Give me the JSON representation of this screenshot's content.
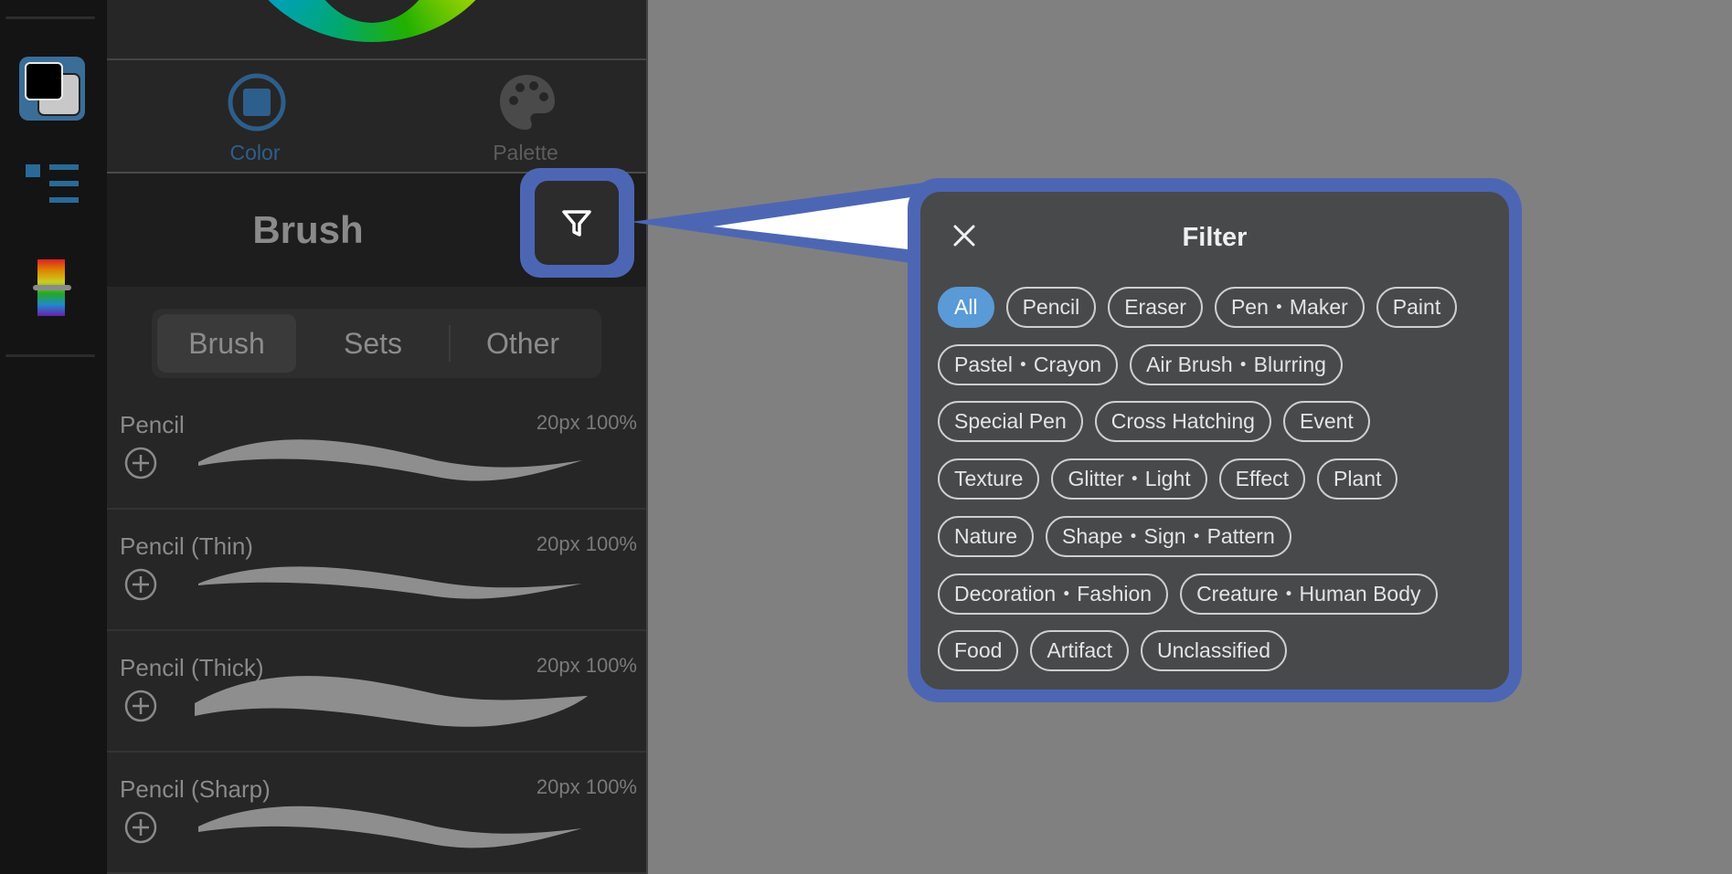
{
  "color_panel": {
    "tabs": [
      {
        "label": "Color",
        "icon": "color-square-icon",
        "active": true
      },
      {
        "label": "Palette",
        "icon": "palette-icon",
        "active": false
      }
    ]
  },
  "brush_panel": {
    "title": "Brush",
    "filter_icon": "funnel-icon",
    "segments": [
      "Brush",
      "Sets",
      "Other"
    ],
    "selected_segment": "Brush",
    "brushes": [
      {
        "name": "Pencil",
        "size": "20px",
        "opacity": "100%"
      },
      {
        "name": "Pencil (Thin)",
        "size": "20px",
        "opacity": "100%"
      },
      {
        "name": "Pencil (Thick)",
        "size": "20px",
        "opacity": "100%"
      },
      {
        "name": "Pencil (Sharp)",
        "size": "20px",
        "opacity": "100%"
      }
    ]
  },
  "filter_popup": {
    "title": "Filter",
    "close_icon": "close-icon",
    "selected": "All",
    "categories": [
      [
        "All",
        "Pencil",
        "Eraser",
        "Pen・Maker",
        "Paint"
      ],
      [
        "Pastel・Crayon",
        "Air Brush・Blurring"
      ],
      [
        "Special Pen",
        "Cross Hatching",
        "Event"
      ],
      [
        "Texture",
        "Glitter・Light",
        "Effect",
        "Plant"
      ],
      [
        "Nature",
        "Shape・Sign・Pattern"
      ],
      [
        "Decoration・Fashion",
        "Creature・Human Body"
      ],
      [
        "Food",
        "Artifact",
        "Unclassified"
      ]
    ]
  },
  "colors": {
    "accent": "#5a9ad6",
    "highlight_outline": "#4d66b4",
    "panel_bg": "#262626",
    "popup_bg": "#48494b",
    "canvas_bg": "#808080"
  }
}
